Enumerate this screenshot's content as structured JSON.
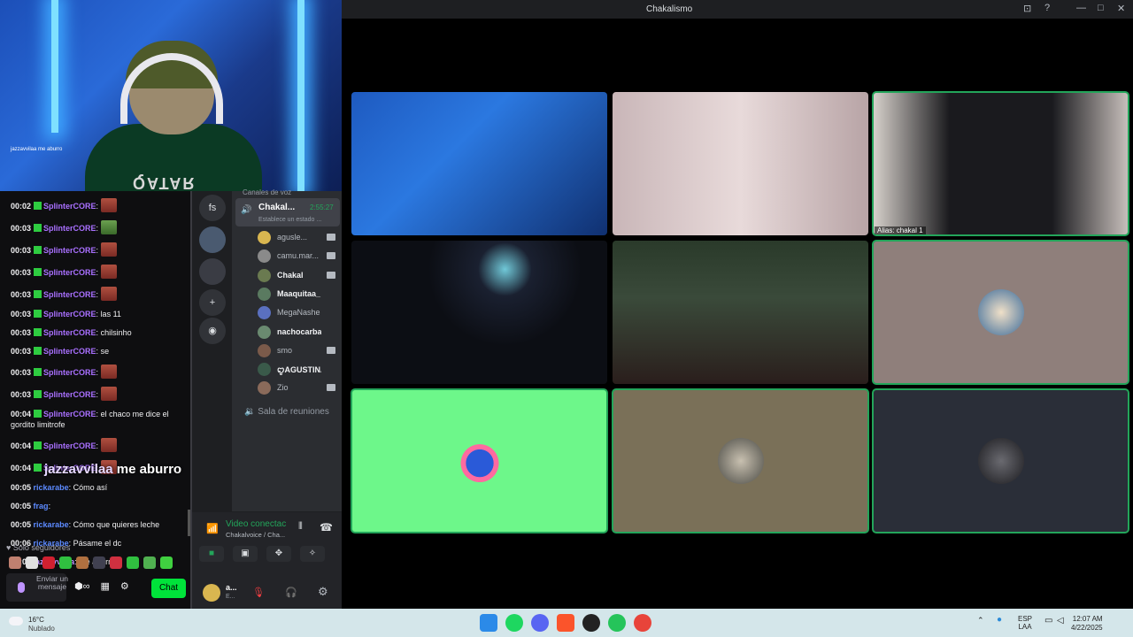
{
  "webcam": {
    "overlay_text": "jazzavvilaa  me aburro",
    "shirt_text": "QATAR"
  },
  "big_overlay": {
    "user": "jazzavvilaa",
    "message": "me aburro"
  },
  "chat": {
    "lines": [
      {
        "t": "00:02",
        "u": "SplinterCORE",
        "c": "#a970ff",
        "m": "",
        "emote": "r"
      },
      {
        "t": "00:03",
        "u": "SplinterCORE",
        "c": "#a970ff",
        "m": "",
        "emote": "g"
      },
      {
        "t": "00:03",
        "u": "SplinterCORE",
        "c": "#a970ff",
        "m": "",
        "emote": "r"
      },
      {
        "t": "00:03",
        "u": "SplinterCORE",
        "c": "#a970ff",
        "m": "",
        "emote": "r"
      },
      {
        "t": "00:03",
        "u": "SplinterCORE",
        "c": "#a970ff",
        "m": "",
        "emote": "r"
      },
      {
        "t": "00:03",
        "u": "SplinterCORE",
        "c": "#a970ff",
        "m": "las 11",
        "emote": ""
      },
      {
        "t": "00:03",
        "u": "SplinterCORE",
        "c": "#a970ff",
        "m": "chilsinho",
        "emote": ""
      },
      {
        "t": "00:03",
        "u": "SplinterCORE",
        "c": "#a970ff",
        "m": "se",
        "emote": ""
      },
      {
        "t": "00:03",
        "u": "SplinterCORE",
        "c": "#a970ff",
        "m": "",
        "emote": "r"
      },
      {
        "t": "00:03",
        "u": "SplinterCORE",
        "c": "#a970ff",
        "m": "",
        "emote": "r"
      },
      {
        "t": "00:04",
        "u": "SplinterCORE",
        "c": "#a970ff",
        "m": "el chaco me dice el gordito limitrofe",
        "emote": ""
      },
      {
        "t": "00:04",
        "u": "SplinterCORE",
        "c": "#a970ff",
        "m": "",
        "emote": "r"
      },
      {
        "t": "00:04",
        "u": "SplinterCORE",
        "c": "#a970ff",
        "m": "",
        "emote": "r"
      },
      {
        "t": "00:05",
        "u": "rickarabe",
        "c": "#5c8aff",
        "m": "Cómo así",
        "emote": ""
      },
      {
        "t": "00:05",
        "u": "frag",
        "c": "#5c8aff",
        "m": "",
        "emote": ""
      },
      {
        "t": "00:05",
        "u": "rickarabe",
        "c": "#5c8aff",
        "m": "Cómo que quieres leche",
        "emote": ""
      },
      {
        "t": "00:06",
        "u": "rickarabe",
        "c": "#5c8aff",
        "m": "Pásame el dc",
        "emote": ""
      },
      {
        "t": "00:06",
        "u": "jazzavvilaa",
        "c": "#bf94ff",
        "m": "me aburro",
        "emote": ""
      }
    ],
    "follower_mode": "♥ Solo seguidores",
    "input_placeholder": "Enviar un mensaje",
    "send_label": "Chat"
  },
  "discord": {
    "server_label": "fs",
    "voice_category": "Canales de voz",
    "channel_name": "Chakal...",
    "channel_time": "2:55:27",
    "channel_status": "Establece un estado ...",
    "members": [
      {
        "name": "agusle...",
        "bold": false,
        "cam": true
      },
      {
        "name": "camu.mar...",
        "bold": false,
        "cam": true
      },
      {
        "name": "Chakal",
        "bold": true,
        "cam": true
      },
      {
        "name": "Maaquitaa_",
        "bold": true,
        "cam": false
      },
      {
        "name": "MegaNashe",
        "bold": false,
        "cam": false
      },
      {
        "name": "nachocarba",
        "bold": true,
        "cam": false
      },
      {
        "name": "smo",
        "bold": false,
        "cam": true
      },
      {
        "name": "ꨄAGUSTINAꨄ",
        "bold": true,
        "cam": false
      },
      {
        "name": "Zio",
        "bold": false,
        "cam": true
      }
    ],
    "meeting_room": "Sala de reuniones",
    "vc_connected": "Video conectac",
    "vc_channel": "Chakalvoice / Cha...",
    "user_name": "a...",
    "user_status": "E..."
  },
  "call_window": {
    "title": "Chakalismo",
    "tiles": [
      {
        "alias": ""
      },
      {
        "alias": ""
      },
      {
        "alias": "Alias: chakal 1"
      },
      {
        "alias": ""
      },
      {
        "alias": ""
      },
      {
        "alias": ""
      },
      {
        "alias": ""
      },
      {
        "alias": ""
      },
      {
        "alias": ""
      }
    ]
  },
  "taskbar": {
    "temp": "16°C",
    "condition": "Nublado",
    "lang1": "ESP",
    "lang2": "LAA",
    "time": "12:07 AM",
    "date": "4/22/2025"
  },
  "colors": {
    "discord_green": "#23a55a",
    "twitch_purple": "#a970ff",
    "twitch_chat_btn": "#00e33a",
    "speaking_outline": "#23a55a"
  }
}
